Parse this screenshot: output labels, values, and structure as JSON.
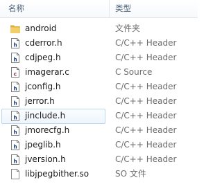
{
  "columns": {
    "name": "名称",
    "type": "类型"
  },
  "files": [
    {
      "name": "android",
      "type": "文件夹",
      "icon": "folder-icon"
    },
    {
      "name": "cderror.h",
      "type": "C/C++ Header",
      "icon": "header-file-icon"
    },
    {
      "name": "cdjpeg.h",
      "type": "C/C++ Header",
      "icon": "header-file-icon"
    },
    {
      "name": "imagerar.c",
      "type": "C Source",
      "icon": "c-source-file-icon"
    },
    {
      "name": "jconfig.h",
      "type": "C/C++ Header",
      "icon": "header-file-icon"
    },
    {
      "name": "jerror.h",
      "type": "C/C++ Header",
      "icon": "header-file-icon"
    },
    {
      "name": "jinclude.h",
      "type": "C/C++ Header",
      "icon": "header-file-icon",
      "selected": true
    },
    {
      "name": "jmorecfg.h",
      "type": "C/C++ Header",
      "icon": "header-file-icon"
    },
    {
      "name": "jpeglib.h",
      "type": "C/C++ Header",
      "icon": "header-file-icon"
    },
    {
      "name": "jversion.h",
      "type": "C/C++ Header",
      "icon": "header-file-icon"
    },
    {
      "name": "libjpegbither.so",
      "type": "SO 文件",
      "icon": "so-file-icon"
    }
  ]
}
